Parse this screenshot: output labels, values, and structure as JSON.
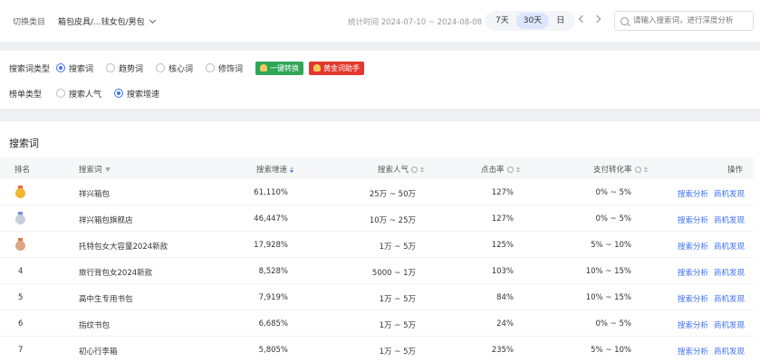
{
  "header": {
    "category_label": "切换类目",
    "category_value": "箱包皮具/...钱女包/男包",
    "stat_time": "统计时间 2024-07-10 ~ 2024-08-08",
    "ranges": [
      "7天",
      "30天",
      "日"
    ],
    "active_range": "30天",
    "search_placeholder": "请输入搜索词，进行深度分析"
  },
  "filters": {
    "search_type_label": "搜索词类型",
    "search_types": [
      "搜索词",
      "趋势词",
      "核心词",
      "修饰词"
    ],
    "selected_search_type": "搜索词",
    "tool_buttons": [
      "一键转换",
      "黄金词助手"
    ],
    "rank_type_label": "榜单类型",
    "rank_types": [
      "搜索人气",
      "搜索增速"
    ],
    "selected_rank_type": "搜索增速"
  },
  "table": {
    "section_title": "搜索词",
    "headers": {
      "rank": "排名",
      "keyword": "搜索词",
      "growth": "搜索增速",
      "popularity": "搜索人气",
      "ctr": "点击率",
      "conversion": "支付转化率",
      "actions": "操作"
    },
    "action_labels": [
      "搜索分析",
      "商机发现"
    ],
    "rows": [
      {
        "rank": "1",
        "medal": "gold",
        "keyword": "祥兴箱包",
        "growth": "61,110%",
        "popularity": "25万 ~ 50万",
        "ctr": "127%",
        "conversion": "0% ~ 5%"
      },
      {
        "rank": "2",
        "medal": "silver",
        "keyword": "祥兴箱包旗舰店",
        "growth": "46,447%",
        "popularity": "10万 ~ 25万",
        "ctr": "127%",
        "conversion": "0% ~ 5%"
      },
      {
        "rank": "3",
        "medal": "bronze",
        "keyword": "托特包女大容量2024新款",
        "growth": "17,928%",
        "popularity": "1万 ~ 5万",
        "ctr": "125%",
        "conversion": "5% ~ 10%"
      },
      {
        "rank": "4",
        "medal": "",
        "keyword": "旅行背包女2024新款",
        "growth": "8,528%",
        "popularity": "5000 ~ 1万",
        "ctr": "103%",
        "conversion": "10% ~ 15%"
      },
      {
        "rank": "5",
        "medal": "",
        "keyword": "高中生专用书包",
        "growth": "7,919%",
        "popularity": "1万 ~ 5万",
        "ctr": "84%",
        "conversion": "10% ~ 15%"
      },
      {
        "rank": "6",
        "medal": "",
        "keyword": "指纹书包",
        "growth": "6,685%",
        "popularity": "1万 ~ 5万",
        "ctr": "24%",
        "conversion": "0% ~ 5%"
      },
      {
        "rank": "7",
        "medal": "",
        "keyword": "初心行李箱",
        "growth": "5,805%",
        "popularity": "1万 ~ 5万",
        "ctr": "235%",
        "conversion": "5% ~ 10%"
      }
    ]
  }
}
